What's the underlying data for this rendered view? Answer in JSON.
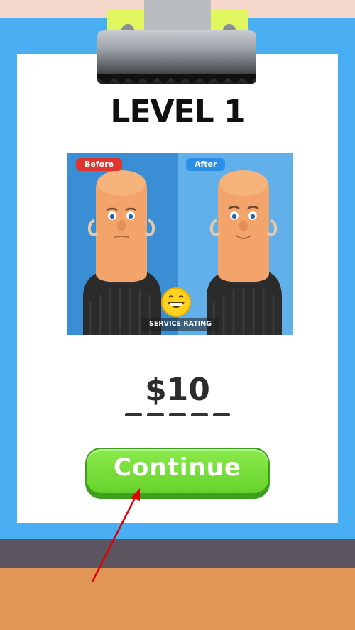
{
  "level": {
    "title": "LEVEL 1"
  },
  "preview": {
    "before_label": "Before",
    "after_label": "After",
    "rating_label": "SERVICE RATING",
    "rating_icon": "grinning-face-icon"
  },
  "reward": {
    "amount": "$10"
  },
  "actions": {
    "continue_label": "Continue"
  },
  "colors": {
    "board": "#4aaef2",
    "paper": "#ffffff",
    "continue_button": "#67d22c",
    "before_tag": "#e0342e",
    "after_tag": "#2a8ee8",
    "pointer_arrow": "#e00000"
  }
}
